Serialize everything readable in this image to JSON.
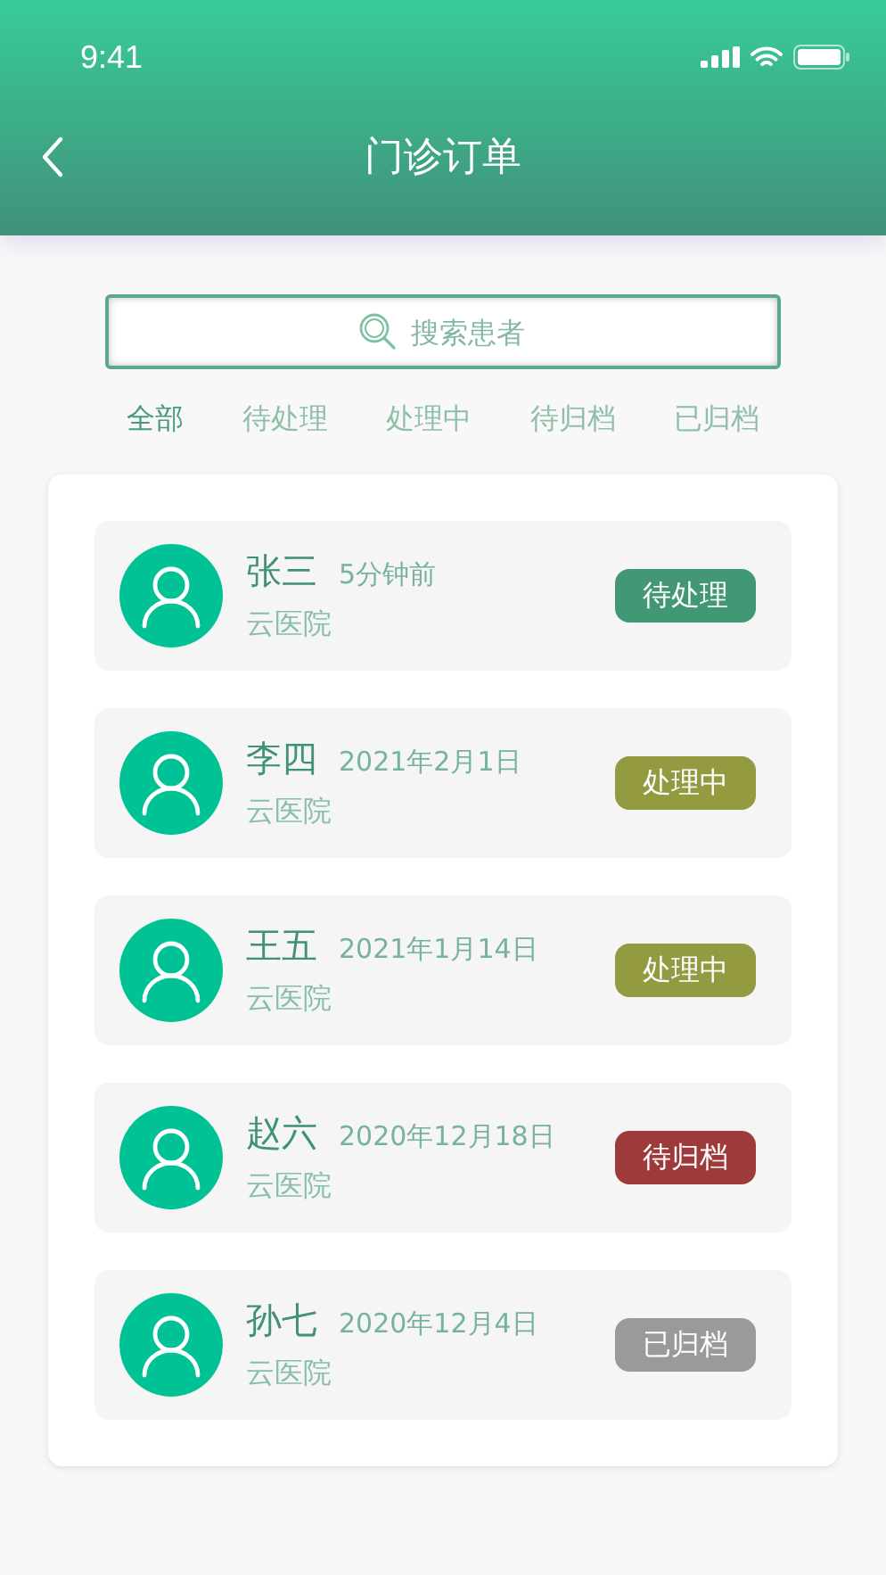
{
  "status_bar": {
    "time": "9:41"
  },
  "header": {
    "title": "门诊订单"
  },
  "search": {
    "placeholder": "搜索患者"
  },
  "tabs": [
    {
      "label": "全部",
      "selected": true
    },
    {
      "label": "待处理",
      "selected": false
    },
    {
      "label": "处理中",
      "selected": false
    },
    {
      "label": "待归档",
      "selected": false
    },
    {
      "label": "已归档",
      "selected": false
    }
  ],
  "orders": [
    {
      "name": "张三",
      "time": "5分钟前",
      "hospital": "云医院",
      "status": "待处理",
      "color": "#429874"
    },
    {
      "name": "李四",
      "time": "2021年2月1日",
      "hospital": "云医院",
      "status": "处理中",
      "color": "#939a3f"
    },
    {
      "name": "王五",
      "time": "2021年1月14日",
      "hospital": "云医院",
      "status": "处理中",
      "color": "#939a3f"
    },
    {
      "name": "赵六",
      "time": "2020年12月18日",
      "hospital": "云医院",
      "status": "待归档",
      "color": "#9e3a3a"
    },
    {
      "name": "孙七",
      "time": "2020年12月4日",
      "hospital": "云医院",
      "status": "已归档",
      "color": "#9a9a9a"
    }
  ]
}
